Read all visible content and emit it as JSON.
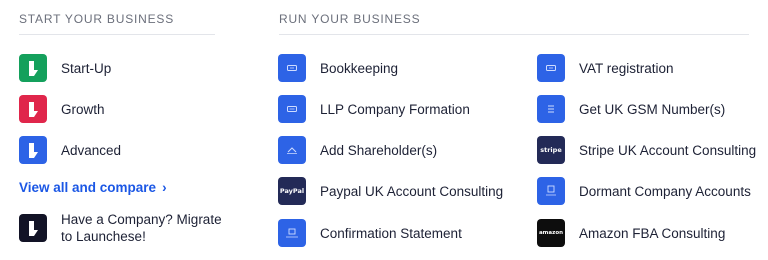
{
  "start": {
    "title": "START YOUR BUSINESS",
    "items": [
      {
        "label": "Start-Up",
        "icon": "launch-icon-green",
        "color": "#14a05c"
      },
      {
        "label": "Growth",
        "icon": "launch-icon-red",
        "color": "#e0264b"
      },
      {
        "label": "Advanced",
        "icon": "launch-icon-blue",
        "color": "#2d63e6"
      }
    ],
    "view_all": "View all and compare",
    "view_all_chevron": "›",
    "migrate_line1": "Have a Company? Migrate",
    "migrate_line2": "to Launchese!"
  },
  "run": {
    "title": "RUN YOUR BUSINESS",
    "left": [
      {
        "label": "Bookkeeping",
        "icon": "bookkeeping-icon"
      },
      {
        "label": "LLP Company Formation",
        "icon": "llp-formation-icon"
      },
      {
        "label": "Add Shareholder(s)",
        "icon": "add-shareholder-icon"
      },
      {
        "label": "Paypal UK Account Consulting",
        "icon": "paypal-icon",
        "icon_text": "PayPal"
      },
      {
        "label": "Confirmation Statement",
        "icon": "confirmation-statement-icon"
      }
    ],
    "right": [
      {
        "label": "VAT registration",
        "icon": "vat-icon"
      },
      {
        "label": "Get UK GSM Number(s)",
        "icon": "gsm-number-icon"
      },
      {
        "label": "Stripe UK Account Consulting",
        "icon": "stripe-icon",
        "icon_text": "stripe"
      },
      {
        "label": "Dormant Company Accounts",
        "icon": "dormant-accounts-icon"
      },
      {
        "label": "Amazon FBA Consulting",
        "icon": "amazon-icon",
        "icon_text": "amazon"
      }
    ]
  },
  "colors": {
    "accent": "#1b57e5",
    "tile_blue": "#2d63e6",
    "tile_navy": "#232a57",
    "tile_black": "#0d0d0d"
  }
}
